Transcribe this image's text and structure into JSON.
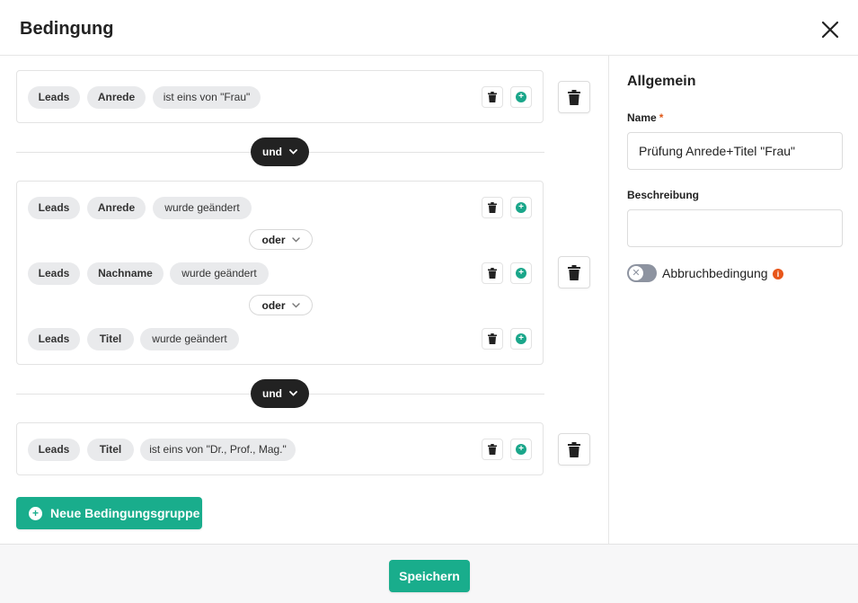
{
  "dialog": {
    "title": "Bedingung"
  },
  "groups": [
    {
      "rows": [
        {
          "entity": "Leads",
          "field": "Anrede",
          "condition": "ist eins von \"Frau\""
        }
      ]
    },
    {
      "rows": [
        {
          "entity": "Leads",
          "field": "Anrede",
          "condition": "wurde geändert"
        },
        {
          "entity": "Leads",
          "field": "Nachname",
          "condition": "wurde geändert"
        },
        {
          "entity": "Leads",
          "field": "Titel",
          "condition": "wurde geändert"
        }
      ],
      "connectors": [
        "oder",
        "oder"
      ]
    },
    {
      "rows": [
        {
          "entity": "Leads",
          "field": "Titel",
          "condition": "ist eins von \"Dr., Prof., Mag.\""
        }
      ]
    }
  ],
  "group_connectors": [
    "und",
    "und"
  ],
  "new_group_button": "Neue Bedingungsgruppe",
  "sidebar": {
    "section_title": "Allgemein",
    "name_label": "Name",
    "name_required": "*",
    "name_value": "Prüfung Anrede+Titel \"Frau\"",
    "description_label": "Beschreibung",
    "description_value": "",
    "abort_label": "Abbruchbedingung",
    "abort_enabled": false,
    "info_glyph": "i"
  },
  "footer": {
    "save_label": "Speichern"
  },
  "colors": {
    "accent": "#19ad8c",
    "dark": "#222222",
    "warning": "#e8561a"
  }
}
